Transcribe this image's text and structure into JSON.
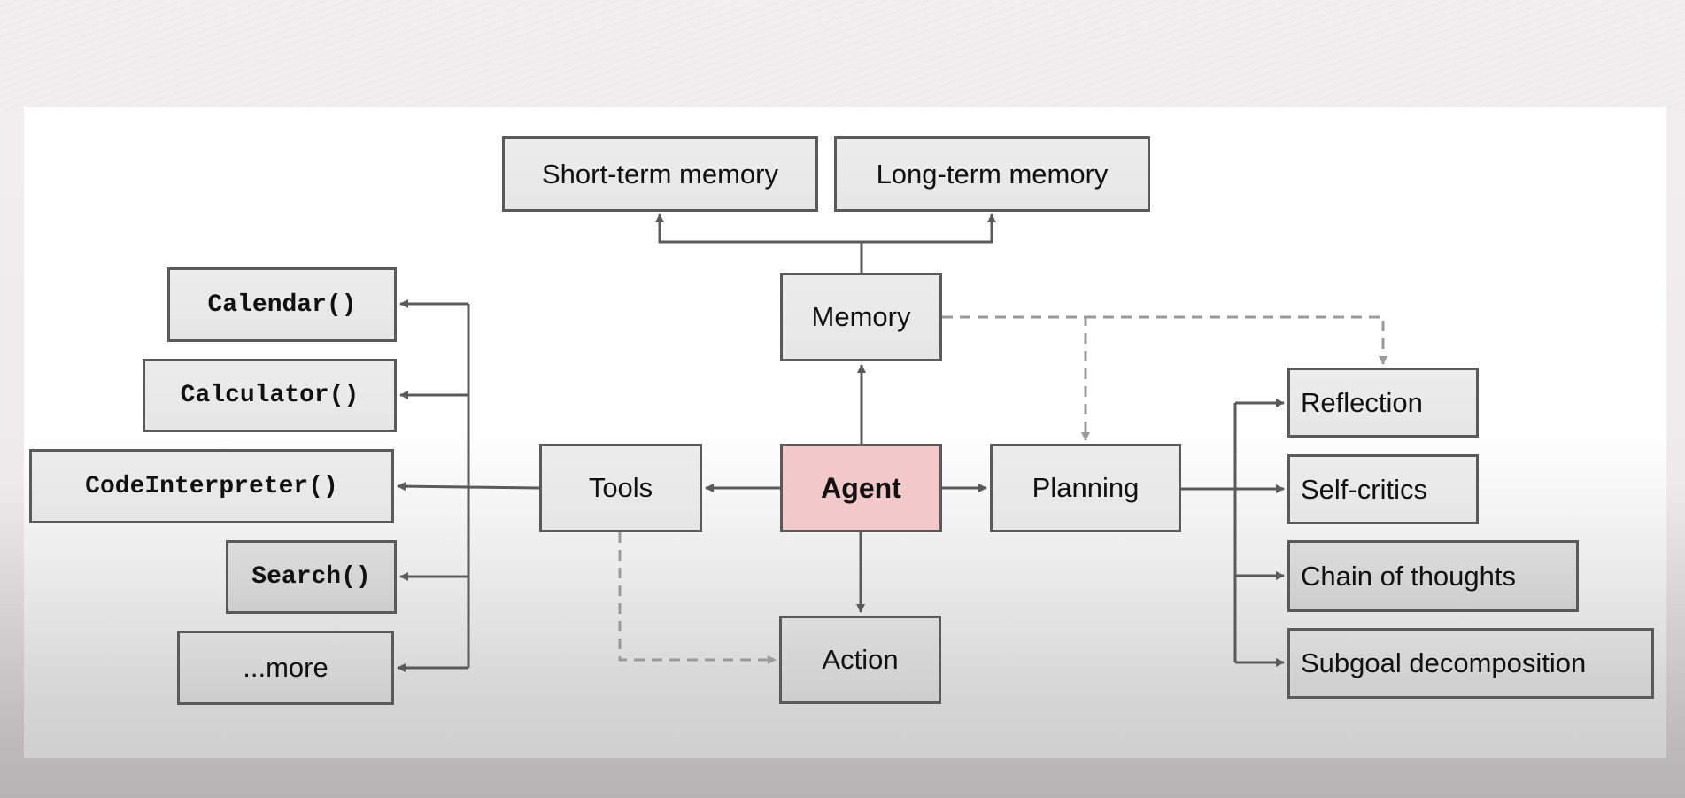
{
  "diagram": {
    "center": {
      "label": "Agent",
      "fill": "#f3c8cb"
    },
    "memory": {
      "label": "Memory",
      "children": [
        "Short-term memory",
        "Long-term memory"
      ]
    },
    "tools": {
      "label": "Tools",
      "children": [
        "Calendar()",
        "Calculator()",
        "CodeInterpreter()",
        "Search()",
        "...more"
      ]
    },
    "planning": {
      "label": "Planning",
      "children": [
        "Reflection",
        "Self-critics",
        "Chain of thoughts",
        "Subgoal decomposition"
      ]
    },
    "action": {
      "label": "Action"
    },
    "edges": [
      {
        "from": "Agent",
        "to": "Memory",
        "style": "solid"
      },
      {
        "from": "Agent",
        "to": "Tools",
        "style": "solid"
      },
      {
        "from": "Agent",
        "to": "Planning",
        "style": "solid"
      },
      {
        "from": "Agent",
        "to": "Action",
        "style": "solid"
      },
      {
        "from": "Memory",
        "to": "Short-term memory",
        "style": "solid"
      },
      {
        "from": "Memory",
        "to": "Long-term memory",
        "style": "solid"
      },
      {
        "from": "Tools",
        "to": "Calendar()",
        "style": "solid"
      },
      {
        "from": "Tools",
        "to": "Calculator()",
        "style": "solid"
      },
      {
        "from": "Tools",
        "to": "CodeInterpreter()",
        "style": "solid"
      },
      {
        "from": "Tools",
        "to": "Search()",
        "style": "solid"
      },
      {
        "from": "Tools",
        "to": "...more",
        "style": "solid"
      },
      {
        "from": "Planning",
        "to": "Reflection",
        "style": "solid"
      },
      {
        "from": "Planning",
        "to": "Self-critics",
        "style": "solid"
      },
      {
        "from": "Planning",
        "to": "Chain of thoughts",
        "style": "solid"
      },
      {
        "from": "Planning",
        "to": "Subgoal decomposition",
        "style": "solid"
      },
      {
        "from": "Memory",
        "to": "Planning",
        "style": "dashed"
      },
      {
        "from": "Memory",
        "to": "Reflection",
        "style": "dashed"
      },
      {
        "from": "Tools",
        "to": "Action",
        "style": "dashed"
      }
    ],
    "colors": {
      "line": "#5a5a5a",
      "dashed": "#9a9a9a"
    }
  }
}
